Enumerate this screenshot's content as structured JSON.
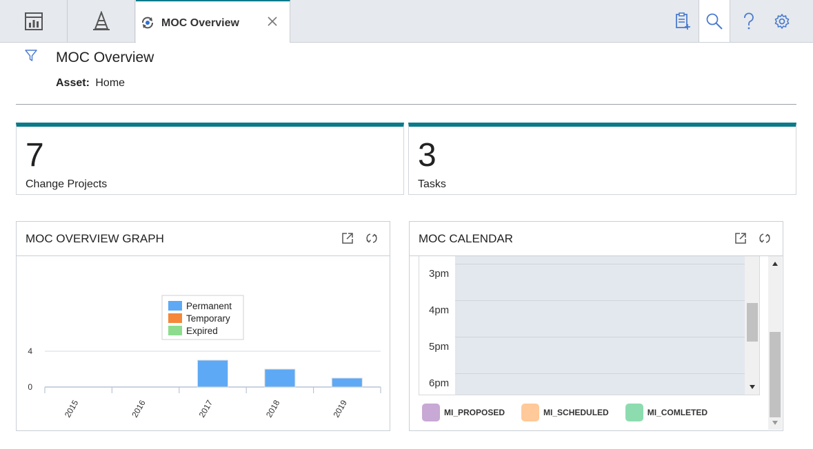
{
  "tab": {
    "label": "MOC Overview"
  },
  "header": {
    "title": "MOC Overview",
    "asset_label": "Asset:",
    "asset_value": "Home"
  },
  "kpis": [
    {
      "value": "7",
      "label": "Change Projects"
    },
    {
      "value": "3",
      "label": "Tasks"
    }
  ],
  "graph_widget": {
    "title": "MOC OVERVIEW GRAPH"
  },
  "calendar_widget": {
    "title": "MOC CALENDAR",
    "times": [
      "3pm",
      "4pm",
      "5pm",
      "6pm"
    ],
    "legend": [
      {
        "label": "MI_PROPOSED",
        "color": "#c8a8d4"
      },
      {
        "label": "MI_SCHEDULED",
        "color": "#ffc999"
      },
      {
        "label": "MI_COMLETED",
        "color": "#8ddcb0"
      }
    ]
  },
  "colors": {
    "accent": "#0b7a8a",
    "icon_blue": "#4a7bd0"
  },
  "chart_data": {
    "type": "bar",
    "categories": [
      "2015",
      "2016",
      "2017",
      "2018",
      "2019"
    ],
    "series": [
      {
        "name": "Permanent",
        "color": "#5ea9f5",
        "values": [
          0,
          0,
          3,
          2,
          1
        ]
      },
      {
        "name": "Temporary",
        "color": "#f5873a",
        "values": [
          0,
          0,
          0,
          0,
          0
        ]
      },
      {
        "name": "Expired",
        "color": "#8ddc8e",
        "values": [
          0,
          0,
          0,
          0,
          0
        ]
      }
    ],
    "yticks": [
      0,
      4
    ],
    "ylim": [
      0,
      4
    ],
    "grid": true,
    "legend_position": "top-center"
  }
}
